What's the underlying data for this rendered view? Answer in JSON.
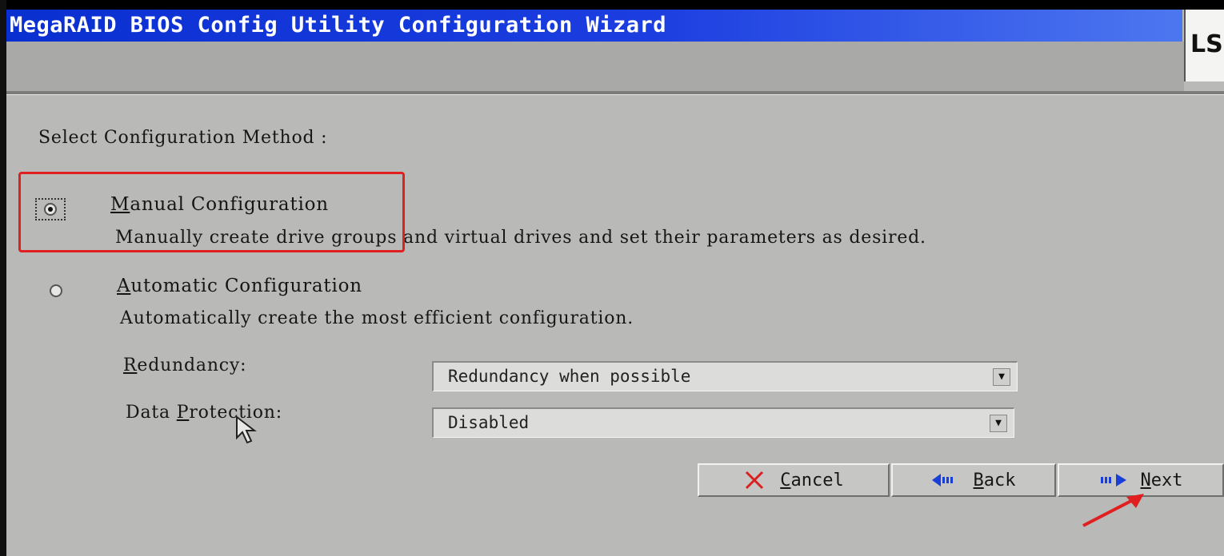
{
  "window": {
    "title": "MegaRAID BIOS Config Utility  Configuration Wizard",
    "logo_text": "LSI"
  },
  "wizard": {
    "heading": "Select Configuration Method :",
    "options": [
      {
        "label_first": "M",
        "label_rest": "anual Configuration",
        "description": "Manually create drive groups and virtual drives and set their parameters as desired.",
        "selected": true
      },
      {
        "label_first": "A",
        "label_rest": "utomatic Configuration",
        "description": "Automatically create the most efficient configuration.",
        "selected": false
      }
    ],
    "fields": [
      {
        "label_first": "R",
        "label_rest": "edundancy:",
        "value": "Redundancy when possible"
      },
      {
        "label_prefix": "Data ",
        "label_first": "P",
        "label_rest": "rotection:",
        "value": "Disabled"
      }
    ]
  },
  "buttons": {
    "cancel": {
      "first": "C",
      "rest": "ancel",
      "icon": "x-icon"
    },
    "back": {
      "first": "B",
      "rest": "ack",
      "icon": "back-arrow-icon"
    },
    "next": {
      "first": "N",
      "rest": "ext",
      "icon": "next-arrow-icon"
    }
  },
  "colors": {
    "title_bar": "#0a2fd0",
    "background": "#b9bab8",
    "annotation": "#e02020",
    "arrow_icon": "#1a3fd8",
    "cancel_icon": "#d82020"
  }
}
